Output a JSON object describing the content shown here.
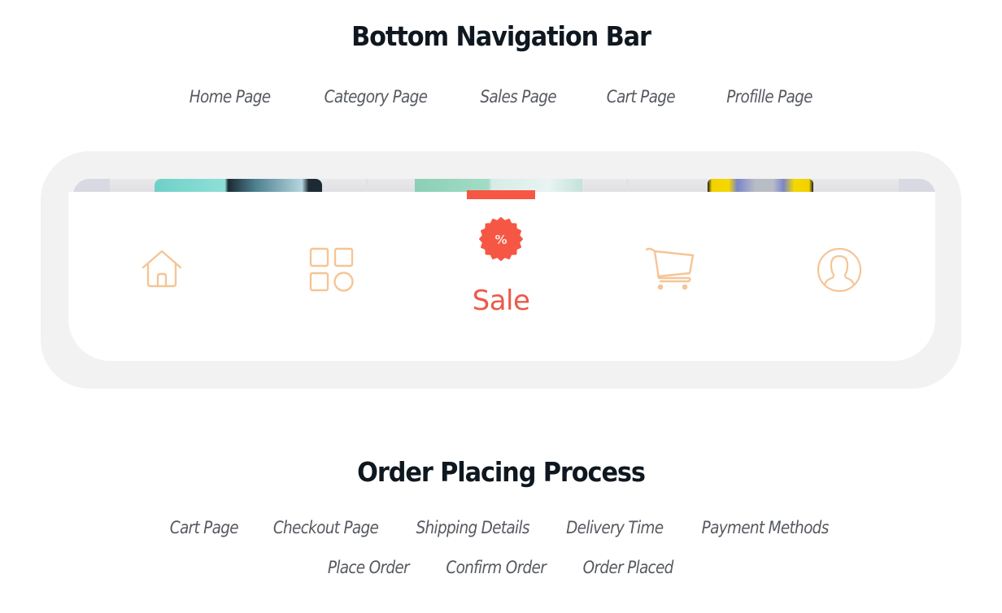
{
  "sections": {
    "bottom_nav": {
      "title": "Bottom Navigation Bar",
      "links": [
        "Home Page",
        "Category Page",
        "Sales Page",
        "Cart Page",
        "Profille Page"
      ]
    },
    "order_process": {
      "title": "Order Placing Process",
      "links_row1": [
        "Cart Page",
        "Checkout Page",
        "Shipping Details",
        "Delivery Time",
        "Payment Methods"
      ],
      "links_row2": [
        "Place Order",
        "Confirm Order",
        "Order Placed"
      ]
    }
  },
  "navbar": {
    "items": [
      {
        "icon": "home-icon",
        "label": ""
      },
      {
        "icon": "category-grid-icon",
        "label": ""
      },
      {
        "icon": "sale-badge-icon",
        "label": "Sale",
        "badge_symbol": "%",
        "active": true
      },
      {
        "icon": "cart-icon",
        "label": ""
      },
      {
        "icon": "profile-icon",
        "label": ""
      }
    ],
    "active_index": 2
  },
  "colors": {
    "icon_inactive": "#f5c596",
    "active_accent": "#f65744",
    "sale_text": "#ea5a4b",
    "title_text": "#0f1720",
    "link_text": "#565a60",
    "frame_bg": "#f2f2f3"
  }
}
